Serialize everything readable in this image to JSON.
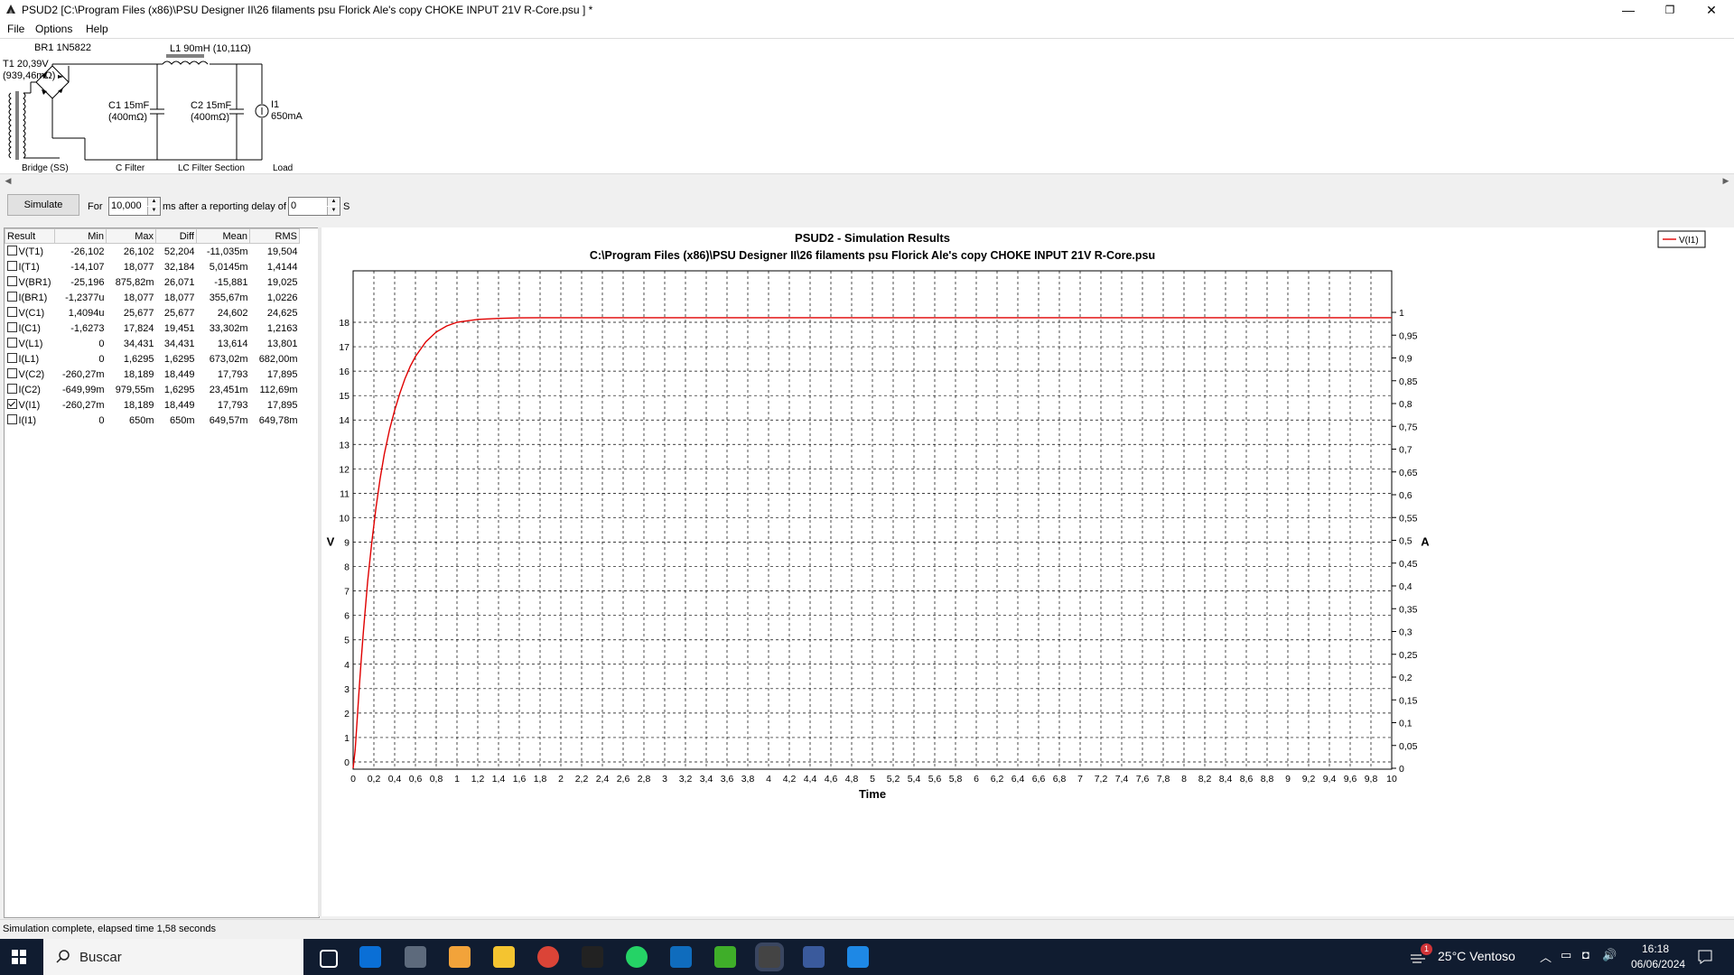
{
  "window": {
    "title": "PSUD2  [C:\\Program Files (x86)\\PSU Designer II\\26 filaments psu Florick Ale's copy CHOKE INPUT 21V R-Core.psu ] *",
    "minimize": "—",
    "maximize": "❐",
    "close": "✕"
  },
  "menu": [
    "File",
    "Options",
    "Help"
  ],
  "schematic": {
    "t1_label": "T1 20,39V",
    "t1_res": "(939,46mΩ)",
    "br1_label": "BR1 1N5822",
    "l1_label": "L1 90mH (10,11Ω)",
    "c1_label": "C1 15mF",
    "c1_res": "(400mΩ)",
    "c2_label": "C2 15mF",
    "c2_res": "(400mΩ)",
    "i1_label": "I1",
    "i1_val": "650mA",
    "sections": [
      "Bridge (SS)",
      "C Filter",
      "LC Filter Section",
      "Load"
    ]
  },
  "controls": {
    "simulate": "Simulate",
    "for": "For",
    "duration": "10,000",
    "ms_after": "ms  after a reporting delay of",
    "delay": "0",
    "s": "S"
  },
  "results": {
    "headers": [
      "Result",
      "Min",
      "Max",
      "Diff",
      "Mean",
      "RMS"
    ],
    "rows": [
      {
        "name": "V(T1)",
        "checked": false,
        "min": "-26,102",
        "max": "26,102",
        "diff": "52,204",
        "mean": "-11,035m",
        "rms": "19,504"
      },
      {
        "name": "I(T1)",
        "checked": false,
        "min": "-14,107",
        "max": "18,077",
        "diff": "32,184",
        "mean": "5,0145m",
        "rms": "1,4144"
      },
      {
        "name": "V(BR1)",
        "checked": false,
        "min": "-25,196",
        "max": "875,82m",
        "diff": "26,071",
        "mean": "-15,881",
        "rms": "19,025"
      },
      {
        "name": "I(BR1)",
        "checked": false,
        "min": "-1,2377u",
        "max": "18,077",
        "diff": "18,077",
        "mean": "355,67m",
        "rms": "1,0226"
      },
      {
        "name": "V(C1)",
        "checked": false,
        "min": "1,4094u",
        "max": "25,677",
        "diff": "25,677",
        "mean": "24,602",
        "rms": "24,625"
      },
      {
        "name": "I(C1)",
        "checked": false,
        "min": "-1,6273",
        "max": "17,824",
        "diff": "19,451",
        "mean": "33,302m",
        "rms": "1,2163"
      },
      {
        "name": "V(L1)",
        "checked": false,
        "min": "0",
        "max": "34,431",
        "diff": "34,431",
        "mean": "13,614",
        "rms": "13,801"
      },
      {
        "name": "I(L1)",
        "checked": false,
        "min": "0",
        "max": "1,6295",
        "diff": "1,6295",
        "mean": "673,02m",
        "rms": "682,00m"
      },
      {
        "name": "V(C2)",
        "checked": false,
        "min": "-260,27m",
        "max": "18,189",
        "diff": "18,449",
        "mean": "17,793",
        "rms": "17,895"
      },
      {
        "name": "I(C2)",
        "checked": false,
        "min": "-649,99m",
        "max": "979,55m",
        "diff": "1,6295",
        "mean": "23,451m",
        "rms": "112,69m"
      },
      {
        "name": "V(I1)",
        "checked": true,
        "min": "-260,27m",
        "max": "18,189",
        "diff": "18,449",
        "mean": "17,793",
        "rms": "17,895"
      },
      {
        "name": "I(I1)",
        "checked": false,
        "min": "0",
        "max": "650m",
        "diff": "650m",
        "mean": "649,57m",
        "rms": "649,78m"
      }
    ]
  },
  "chart_data": {
    "type": "line",
    "title": "PSUD2 - Simulation Results",
    "subtitle": "C:\\Program Files (x86)\\PSU Designer II\\26 filaments psu Florick Ale's copy CHOKE INPUT 21V R-Core.psu",
    "xlabel": "Time",
    "ylabel": "V",
    "y2label": "A",
    "xlim": [
      0,
      10
    ],
    "ylim": [
      -0.5,
      18.5
    ],
    "y2lim": [
      0,
      1
    ],
    "xticks": [
      "0",
      "0,2",
      "0,4",
      "0,6",
      "0,8",
      "1",
      "1,2",
      "1,4",
      "1,6",
      "1,8",
      "2",
      "2,2",
      "2,4",
      "2,6",
      "2,8",
      "3",
      "3,2",
      "3,4",
      "3,6",
      "3,8",
      "4",
      "4,2",
      "4,4",
      "4,6",
      "4,8",
      "5",
      "5,2",
      "5,4",
      "5,6",
      "5,8",
      "6",
      "6,2",
      "6,4",
      "6,6",
      "6,8",
      "7",
      "7,2",
      "7,4",
      "7,6",
      "7,8",
      "8",
      "8,2",
      "8,4",
      "8,6",
      "8,8",
      "9",
      "9,2",
      "9,4",
      "9,6",
      "9,8",
      "10"
    ],
    "yticks": [
      "0",
      "1",
      "2",
      "3",
      "4",
      "5",
      "6",
      "7",
      "8",
      "9",
      "10",
      "11",
      "12",
      "13",
      "14",
      "15",
      "16",
      "17",
      "18"
    ],
    "y2ticks": [
      "0",
      "0,05",
      "0,1",
      "0,15",
      "0,2",
      "0,25",
      "0,3",
      "0,35",
      "0,4",
      "0,45",
      "0,5",
      "0,55",
      "0,6",
      "0,65",
      "0,7",
      "0,75",
      "0,8",
      "0,85",
      "0,9",
      "0,95",
      "1"
    ],
    "grid": true,
    "legend_position": "top-right",
    "series": [
      {
        "name": "V(I1)",
        "color": "#e00000",
        "x": [
          0,
          0.02,
          0.04,
          0.06,
          0.08,
          0.1,
          0.14,
          0.18,
          0.22,
          0.26,
          0.3,
          0.35,
          0.4,
          0.45,
          0.5,
          0.55,
          0.6,
          0.7,
          0.8,
          0.9,
          1.0,
          1.2,
          1.4,
          1.6,
          1.8,
          2.0,
          3,
          4,
          5,
          6,
          7,
          8,
          9,
          10
        ],
        "y": [
          -0.26,
          0.5,
          1.8,
          3.1,
          4.3,
          5.4,
          7.4,
          9.0,
          10.4,
          11.6,
          12.6,
          13.6,
          14.4,
          15.1,
          15.7,
          16.2,
          16.6,
          17.2,
          17.6,
          17.85,
          18.0,
          18.12,
          18.16,
          18.18,
          18.19,
          18.19,
          18.19,
          18.19,
          18.19,
          18.19,
          18.19,
          18.19,
          18.19,
          18.19
        ]
      }
    ]
  },
  "status": "Simulation complete, elapsed time 1,58 seconds",
  "taskbar": {
    "search_placeholder": "Buscar",
    "notif_count": "1",
    "weather": "25°C  Ventoso",
    "time": "16:18",
    "date": "06/06/2024",
    "icons": [
      "start-icon",
      "task-view-icon",
      "store-icon",
      "psud-icon",
      "notes-icon",
      "file-explorer-icon",
      "chrome-icon",
      "7zip-icon",
      "whatsapp-icon",
      "outlook-icon",
      "torrent-icon",
      "psud2-icon",
      "calculator-icon",
      "photos-icon"
    ]
  }
}
